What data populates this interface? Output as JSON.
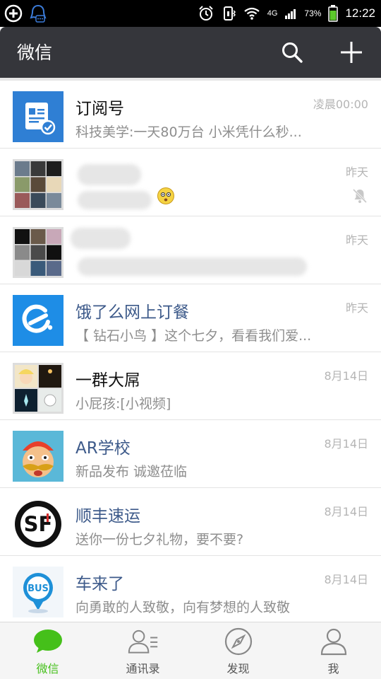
{
  "status_bar": {
    "network": "4G",
    "battery_pct": "73%",
    "time": "12:22"
  },
  "header": {
    "title": "微信",
    "icons": {
      "search": "search-icon",
      "add": "plus-icon"
    }
  },
  "chats": [
    {
      "name": "订阅号",
      "preview": "科技美学:一天80万台 小米凭什么秒...",
      "time": "凌晨00:00",
      "avatar": "subscription-icon"
    },
    {
      "name": "",
      "preview": "",
      "time": "昨天",
      "avatar": "group-collage",
      "muted": true
    },
    {
      "name": "",
      "preview": "",
      "time": "昨天",
      "avatar": "group-collage"
    },
    {
      "name": "饿了么网上订餐",
      "preview": "【 钻石小鸟 】这个七夕，看看我们爱...",
      "time": "昨天",
      "avatar": "eleme-logo"
    },
    {
      "name": "一群大屌",
      "preview": "小屁孩:[小视频]",
      "time": "8月14日",
      "avatar": "group-collage"
    },
    {
      "name": "AR学校",
      "preview": "新品发布 诚邀莅临",
      "time": "8月14日",
      "avatar": "cartoon-avatar"
    },
    {
      "name": "顺丰速运",
      "preview": "送你一份七夕礼物，要不要?",
      "time": "8月14日",
      "avatar": "sf-logo"
    },
    {
      "name": "车来了",
      "preview": "向勇敢的人致敬，向有梦想的人致敬",
      "time": "8月14日",
      "avatar": "bus-logo"
    }
  ],
  "tabs": [
    {
      "label": "微信",
      "icon": "chat-bubble-icon",
      "active": true
    },
    {
      "label": "通讯录",
      "icon": "contacts-icon",
      "active": false
    },
    {
      "label": "发现",
      "icon": "compass-icon",
      "active": false
    },
    {
      "label": "我",
      "icon": "person-icon",
      "active": false
    }
  ],
  "colors": {
    "header_bg": "#35363b",
    "accent_green": "#45c01a",
    "business_name": "#3d5a8a"
  }
}
